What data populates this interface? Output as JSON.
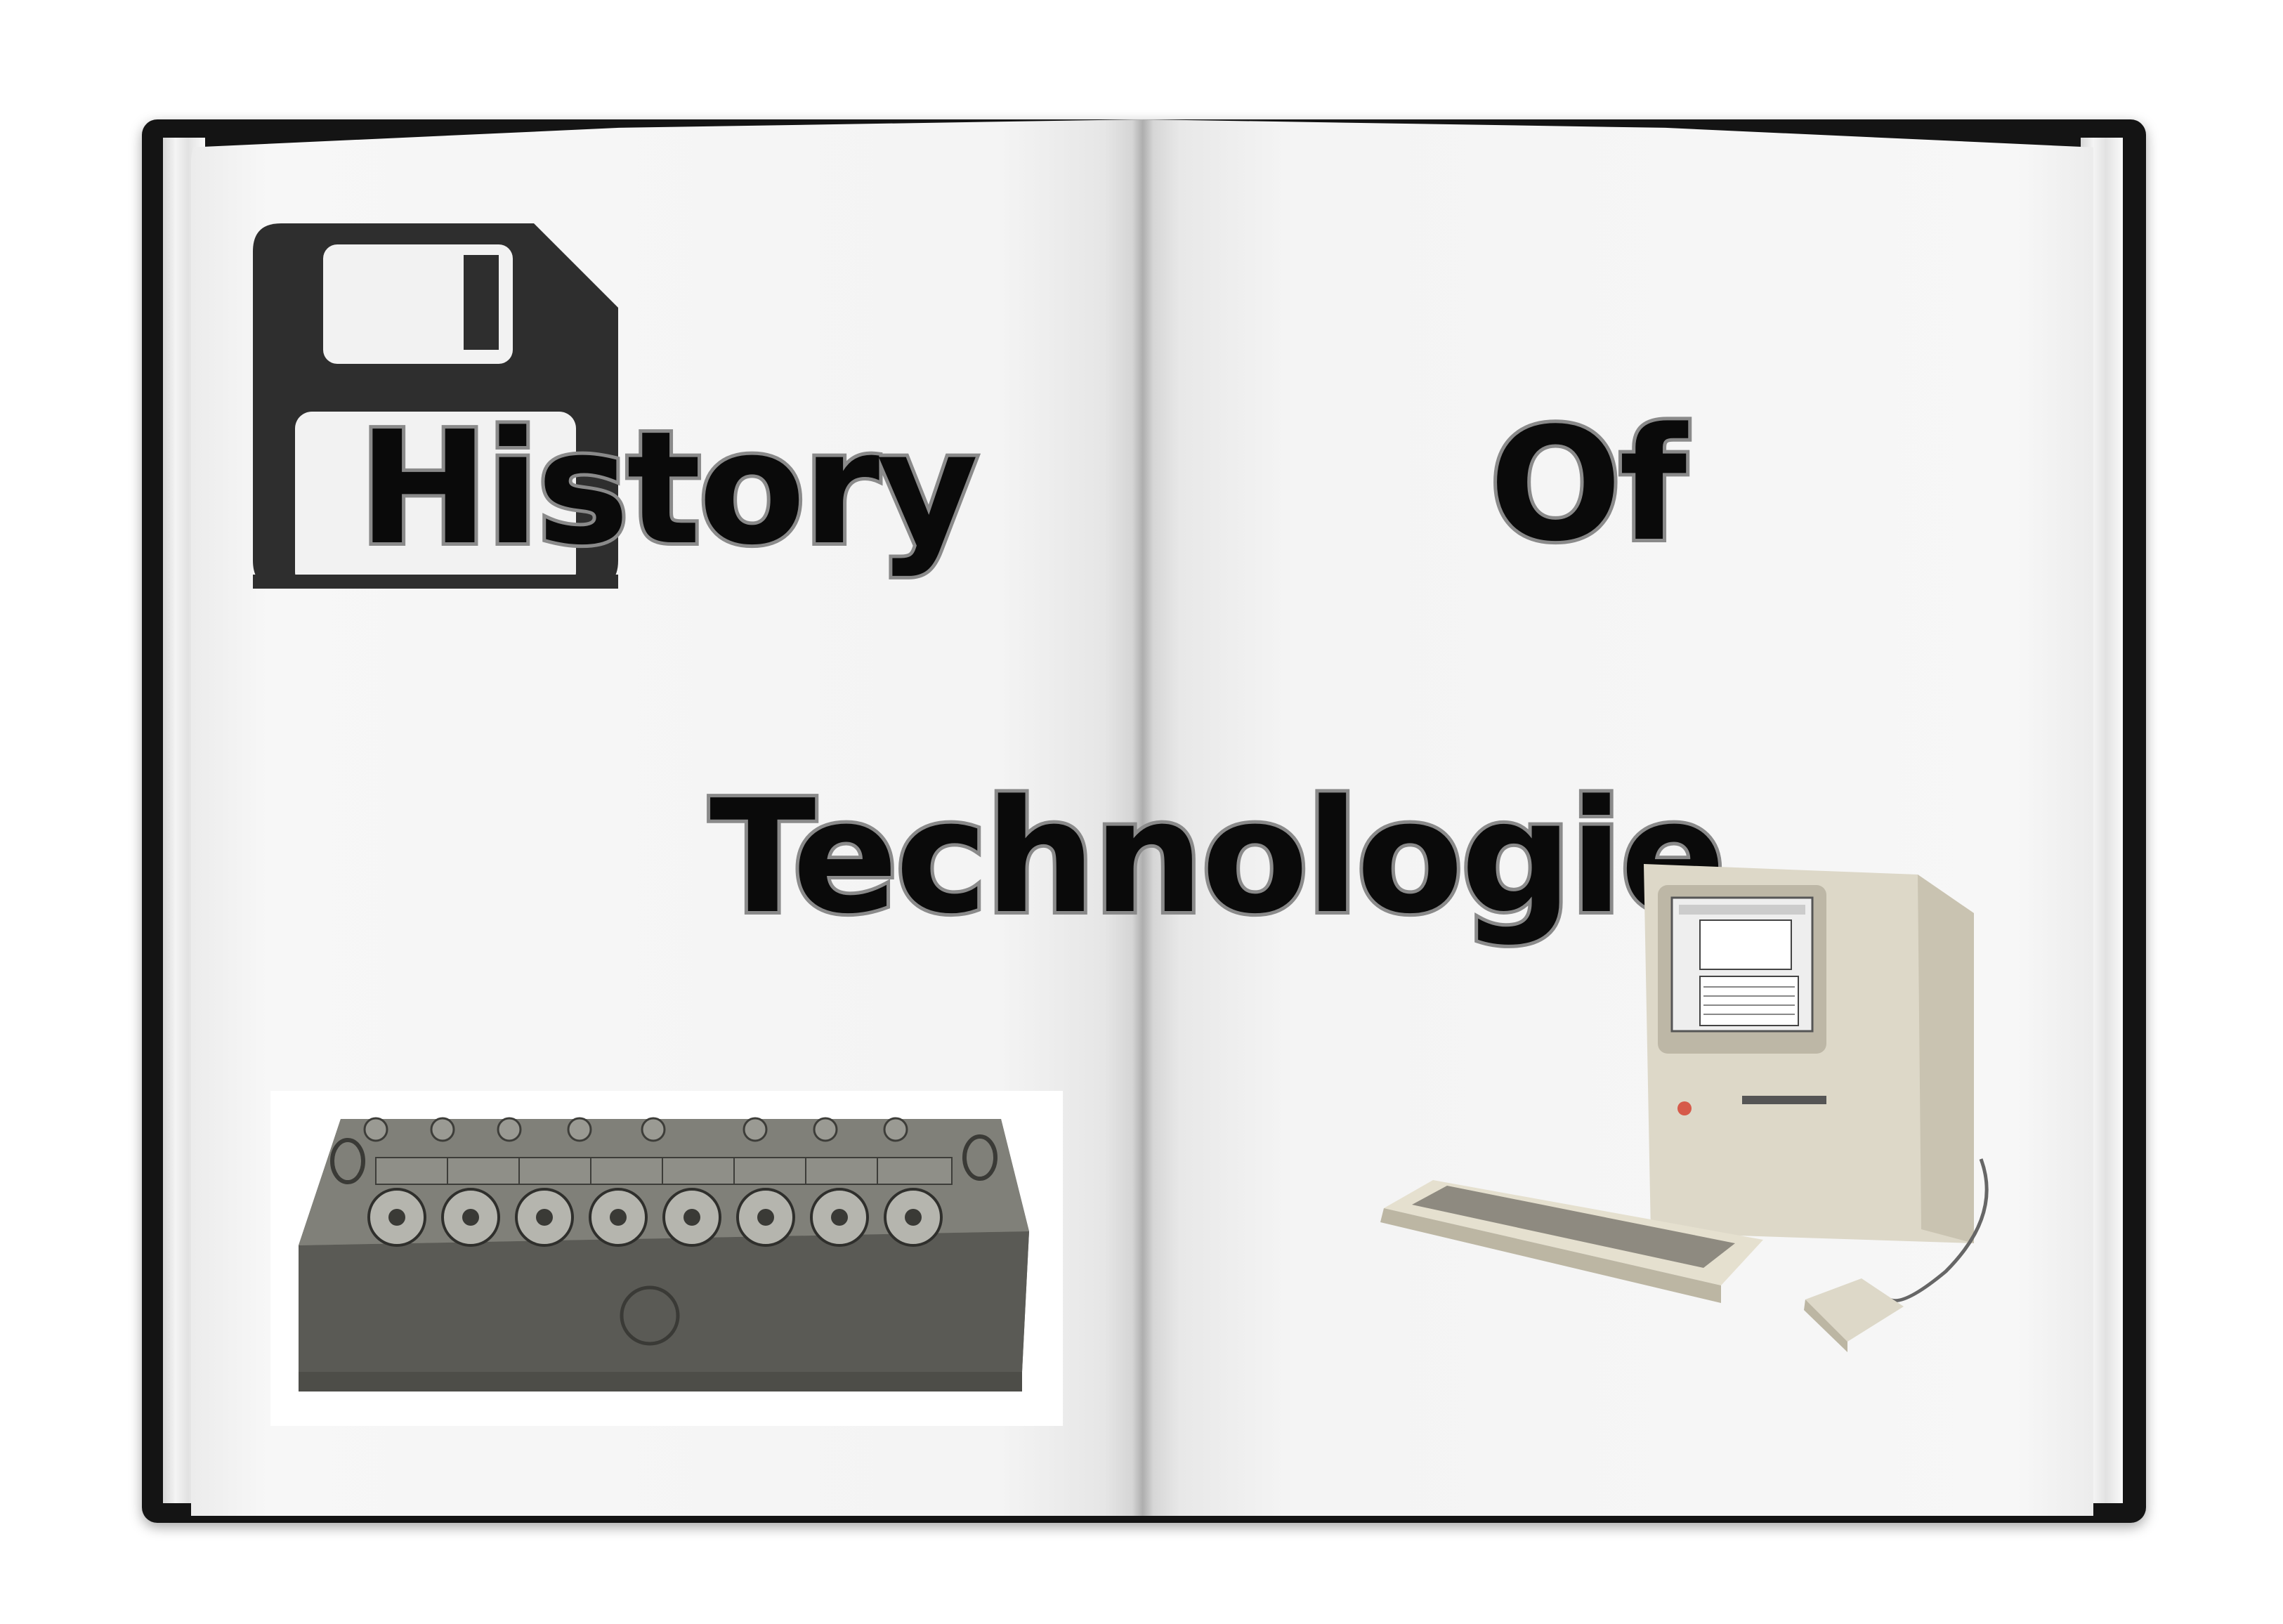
{
  "book": {
    "cover_color": "#141414",
    "page_color": "#f4f4f4"
  },
  "title": {
    "word1": "History",
    "word2": "Of",
    "word3": "Technologie",
    "text_color": "#0a0a0a",
    "outline_color": "#8a8a8a"
  },
  "icons": {
    "floppy": "floppy-disk-icon"
  },
  "images": {
    "left": "pascaline-calculator",
    "right": "macintosh-computer"
  }
}
